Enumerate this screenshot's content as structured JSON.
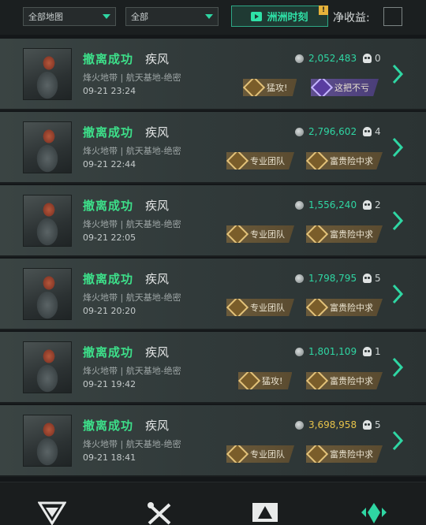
{
  "filters": {
    "map_select": "全部地图",
    "mode_select": "全部",
    "channel_button": "洲洲时刻",
    "notice_badge": "!",
    "net_profit_label": "净收益:"
  },
  "colors": {
    "accent_green": "#2fd6a3",
    "status_green": "#3de08a",
    "gold_value": "#e6c24a"
  },
  "records": [
    {
      "status": "撤离成功",
      "character": "疾风",
      "map_info": "烽火地带 | 航天基地-绝密",
      "time": "09-21 23:24",
      "value": "2,052,483",
      "value_color": "green",
      "kills": "0",
      "badges": [
        {
          "label": "猛攻!",
          "style": "gold"
        },
        {
          "label": "这把不亏",
          "style": "purple"
        }
      ]
    },
    {
      "status": "撤离成功",
      "character": "疾风",
      "map_info": "烽火地带 | 航天基地-绝密",
      "time": "09-21 22:44",
      "value": "2,796,602",
      "value_color": "green",
      "kills": "4",
      "badges": [
        {
          "label": "专业团队",
          "style": "gold"
        },
        {
          "label": "富贵险中求",
          "style": "gold"
        }
      ]
    },
    {
      "status": "撤离成功",
      "character": "疾风",
      "map_info": "烽火地带 | 航天基地-绝密",
      "time": "09-21 22:05",
      "value": "1,556,240",
      "value_color": "green",
      "kills": "2",
      "badges": [
        {
          "label": "专业团队",
          "style": "gold"
        },
        {
          "label": "富贵险中求",
          "style": "gold"
        }
      ]
    },
    {
      "status": "撤离成功",
      "character": "疾风",
      "map_info": "烽火地带 | 航天基地-绝密",
      "time": "09-21 20:20",
      "value": "1,798,795",
      "value_color": "green",
      "kills": "5",
      "badges": [
        {
          "label": "专业团队",
          "style": "gold"
        },
        {
          "label": "富贵险中求",
          "style": "gold"
        }
      ]
    },
    {
      "status": "撤离成功",
      "character": "疾风",
      "map_info": "烽火地带 | 航天基地-绝密",
      "time": "09-21 19:42",
      "value": "1,801,109",
      "value_color": "green",
      "kills": "1",
      "badges": [
        {
          "label": "猛攻!",
          "style": "gold"
        },
        {
          "label": "富贵险中求",
          "style": "gold"
        }
      ]
    },
    {
      "status": "撤离成功",
      "character": "疾风",
      "map_info": "烽火地带 | 航天基地-绝密",
      "time": "09-21 18:41",
      "value": "3,698,958",
      "value_color": "gold",
      "kills": "5",
      "badges": [
        {
          "label": "专业团队",
          "style": "gold"
        },
        {
          "label": "富贵险中求",
          "style": "gold"
        }
      ]
    }
  ],
  "bottom_nav": [
    {
      "icon": "delta-logo-icon",
      "active": false
    },
    {
      "icon": "tools-icon",
      "active": false
    },
    {
      "icon": "warning-card-icon",
      "active": false
    },
    {
      "icon": "diamond-arrows-icon",
      "active": true
    }
  ]
}
